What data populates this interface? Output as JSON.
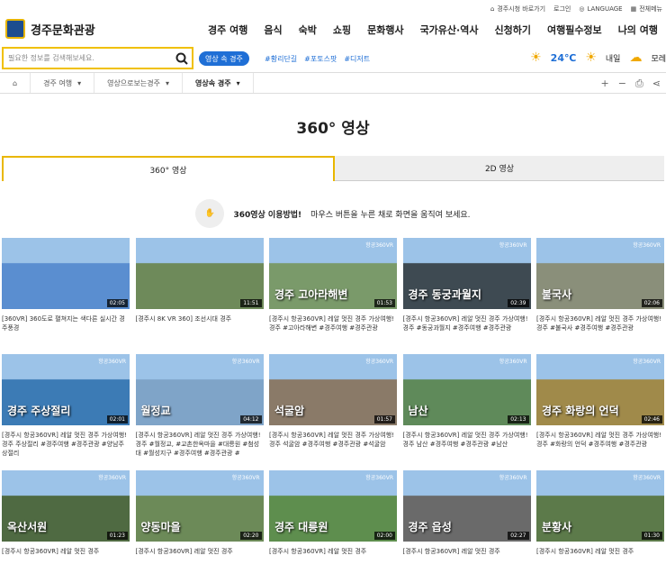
{
  "util": [
    "경주시청 바로가기",
    "로그인",
    "LANGUAGE",
    "전체메뉴"
  ],
  "logo": "경주문화관광",
  "gnb": [
    "경주 여행",
    "음식",
    "숙박",
    "쇼핑",
    "문화행사",
    "국가유산·역사",
    "신청하기",
    "여행필수정보",
    "나의 여행"
  ],
  "search": {
    "placeholder": "필요한 정보를 검색해보세요.",
    "button": "영상 속 경주",
    "tags": [
      "#황리단길",
      "#포토스팟",
      "#디저트"
    ]
  },
  "weather": {
    "temp": "24℃",
    "d1": "내일",
    "d2": "모레"
  },
  "crumb": [
    "경주 여행",
    "영상으로보는경주",
    "영상속 경주"
  ],
  "title": "360° 영상",
  "tabs": [
    "360° 영상",
    "2D 영상"
  ],
  "guide": {
    "bold": "360영상 이용방법!",
    "text": "마우스 버튼을 누른 채로 화면을 움직여 보세요."
  },
  "colors": {
    "accent": "#e9b700",
    "blue": "#1f6fd6"
  },
  "videos": [
    {
      "dur": "02:05",
      "t": "",
      "cap": "[360VR] 360도로 펼쳐지는 색다른 실시간 경주풍경",
      "c": "#5a8ed0"
    },
    {
      "dur": "11:51",
      "t": "",
      "cap": "[경주시 8K VR 360] 조선시대 경주",
      "c": "#6e8a5a"
    },
    {
      "dur": "01:53",
      "t": "경주 고아라해변",
      "cap": "[경주시 항공360VR] 레알 멋진 경주 가상여행! 경주 #고아라해변 #경주여행 #경주관광",
      "c": "#7a9a6a"
    },
    {
      "dur": "02:39",
      "t": "경주 동궁과월지",
      "cap": "[경주시 항공360VR] 레알 멋진 경주 가상여행! 경주 #동궁과월지 #경주여행 #경주관광",
      "c": "#3e4a52"
    },
    {
      "dur": "02:06",
      "t": "불국사",
      "cap": "[경주시 항공360VR] 레알 멋진 경주 가상여행! 경주 #불국사 #경주여행 #경주관광",
      "c": "#8a8f7a"
    },
    {
      "dur": "02:01",
      "t": "경주 주상절리",
      "cap": "[경주시 항공360VR] 레알 멋진 경주 가상여행! 경주 주상절리 #경주여행 #경주관광 #양남주상절리",
      "c": "#3c7bb5"
    },
    {
      "dur": "04:12",
      "t": "월정교",
      "cap": "[경주시 항공360VR] 레알 멋진 경주 가상여행! 경주 #월정교, #교촌한옥마을 #대릉원 #첨성대 #월성지구 #경주여행 #경주관광 #",
      "c": "#7fa4c8"
    },
    {
      "dur": "01:57",
      "t": "석굴암",
      "cap": "[경주시 항공360VR] 레알 멋진 경주 가상여행! 경주 석굴암 #경주여행 #경주관광 #석굴암",
      "c": "#8a7a68"
    },
    {
      "dur": "02:13",
      "t": "남산",
      "cap": "[경주시 항공360VR] 레알 멋진 경주 가상여행! 경주 남산 #경주여행 #경주관광 #남산",
      "c": "#5f8a5a"
    },
    {
      "dur": "02:46",
      "t": "경주 화랑의 언덕",
      "cap": "[경주시 항공360VR] 레알 멋진 경주 가상여행! 경주 #화랑의 언덕 #경주여행 #경주관광",
      "c": "#a08a4a"
    },
    {
      "dur": "01:23",
      "t": "옥산서원",
      "cap": "[경주시 항공360VR] 레알 멋진 경주",
      "c": "#4f6a42"
    },
    {
      "dur": "02:20",
      "t": "양동마을",
      "cap": "[경주시 항공360VR] 레알 멋진 경주",
      "c": "#6c8a58"
    },
    {
      "dur": "02:00",
      "t": "경주 대릉원",
      "cap": "[경주시 항공360VR] 레알 멋진 경주",
      "c": "#5e8e4e"
    },
    {
      "dur": "02:27",
      "t": "경주 읍성",
      "cap": "[경주시 항공360VR] 레알 멋진 경주",
      "c": "#6a6a6a"
    },
    {
      "dur": "01:30",
      "t": "분황사",
      "cap": "[경주시 항공360VR] 레알 멋진 경주",
      "c": "#5c7a4a"
    }
  ]
}
